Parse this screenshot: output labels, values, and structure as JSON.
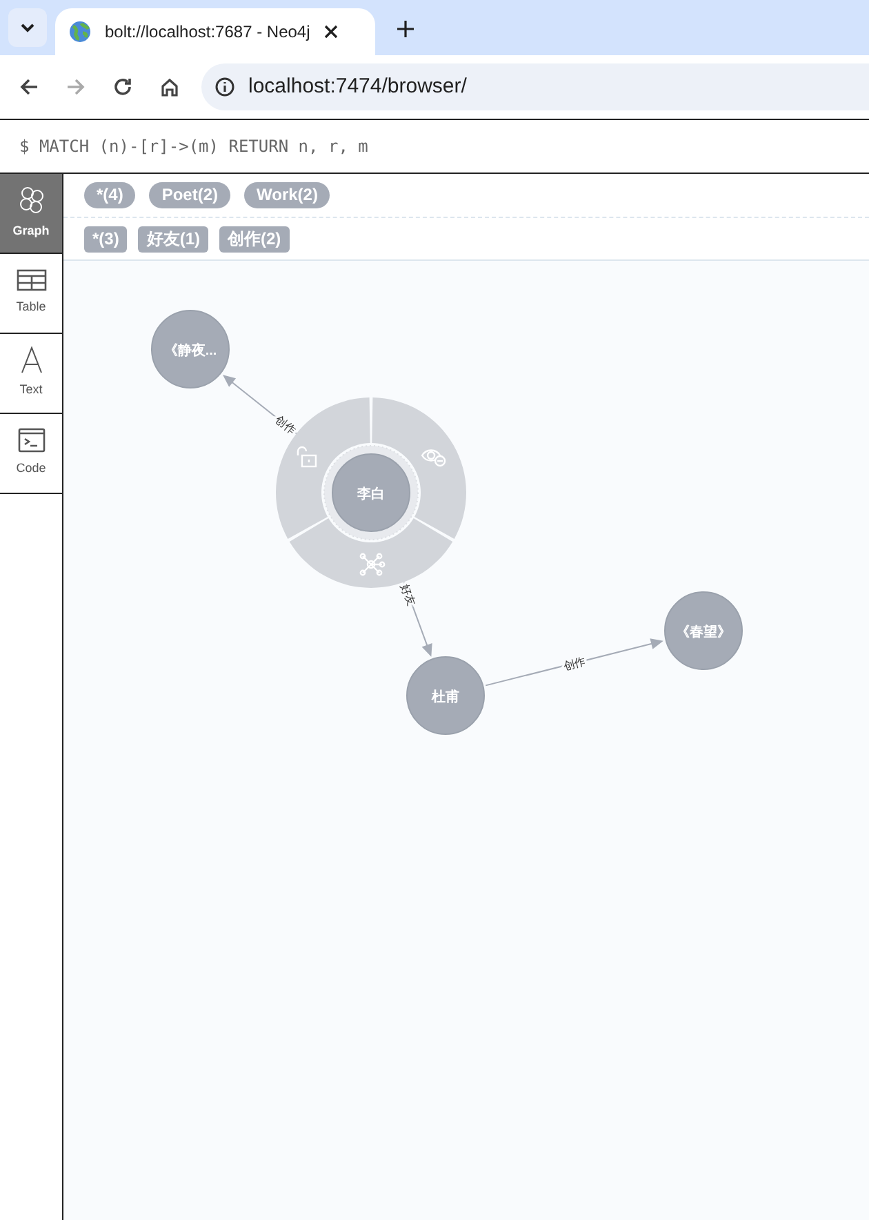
{
  "browser": {
    "tab_title": "bolt://localhost:7687 - Neo4j",
    "url": "localhost:7474/browser/"
  },
  "query": "$ MATCH (n)-[r]->(m) RETURN n, r, m",
  "sidebar": [
    {
      "label": "Graph",
      "selected": true
    },
    {
      "label": "Table",
      "selected": false
    },
    {
      "label": "Text",
      "selected": false
    },
    {
      "label": "Code",
      "selected": false
    }
  ],
  "node_labels": [
    "*(4)",
    "Poet(2)",
    "Work(2)"
  ],
  "relationship_types": [
    "*(3)",
    "好友(1)",
    "创作(2)"
  ],
  "graph": {
    "nodes": [
      {
        "label": "《静夜...",
        "selected": false
      },
      {
        "label": "李白",
        "selected": true
      },
      {
        "label": "杜甫",
        "selected": false
      },
      {
        "label": "《春望》",
        "selected": false
      }
    ],
    "edges": [
      {
        "label": "创作"
      },
      {
        "label": "好友"
      },
      {
        "label": "创作"
      }
    ]
  }
}
